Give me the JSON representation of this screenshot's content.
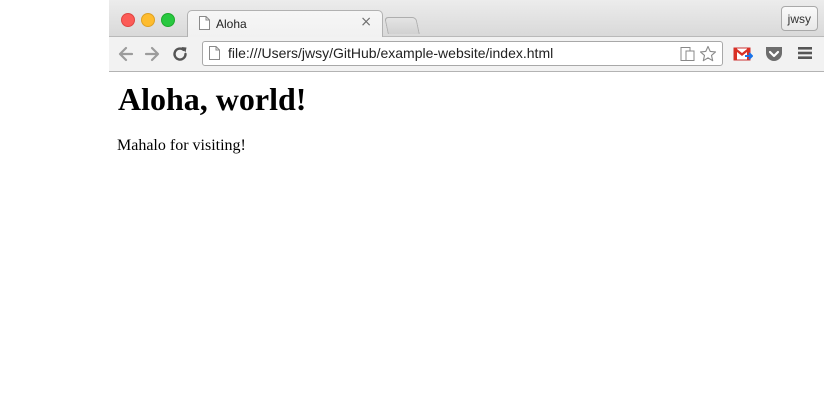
{
  "browser": {
    "tab": {
      "title": "Aloha"
    },
    "profile_label": "jwsy",
    "url": "file:///Users/jwsy/GitHub/example-website/index.html"
  },
  "page": {
    "heading": "Aloha, world!",
    "paragraph": "Mahalo for visiting!"
  },
  "colors": {
    "close": "#fc5b57",
    "minimize": "#febc2e",
    "maximize": "#28c840"
  },
  "icons": [
    "back-arrow-icon",
    "forward-arrow-icon",
    "reload-icon",
    "page-icon",
    "reader-mode-icon",
    "star-icon",
    "gmail-icon",
    "pocket-icon",
    "menu-icon"
  ]
}
